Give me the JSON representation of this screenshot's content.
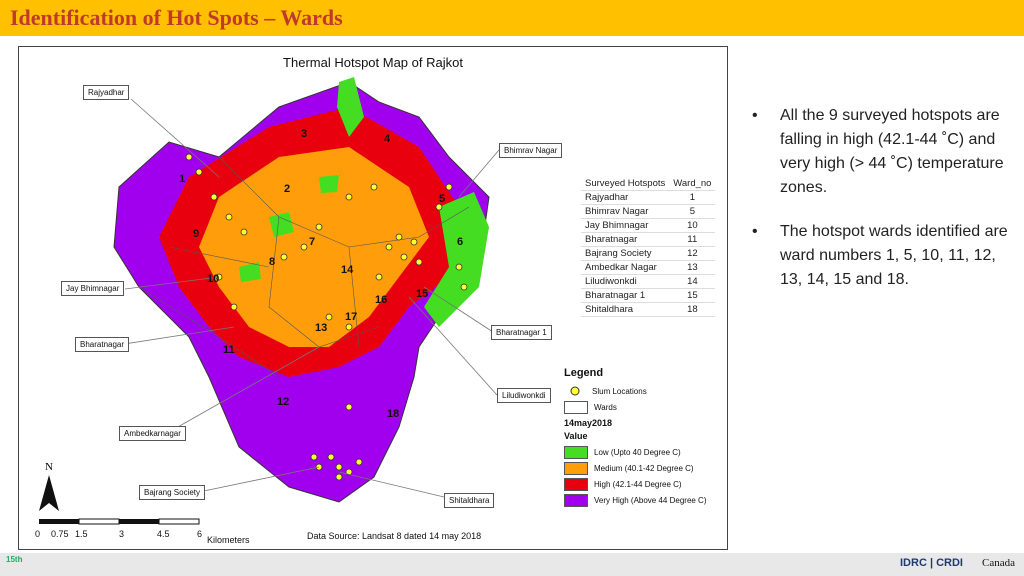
{
  "header": {
    "title": "Identification of Hot Spots – Wards"
  },
  "map": {
    "title": "Thermal Hotspot Map of Rajkot",
    "callouts": [
      "Rajyadhar",
      "Bhimrav Nagar",
      "Jay Bhimnagar",
      "Bharatnagar",
      "Bharatnagar 1",
      "Liludiwonkdi",
      "Ambedkarnagar",
      "Bajrang Society",
      "Shitaldhara"
    ],
    "ward_numbers": [
      "1",
      "2",
      "3",
      "4",
      "5",
      "6",
      "7",
      "8",
      "9",
      "10",
      "11",
      "12",
      "13",
      "14",
      "15",
      "16",
      "17",
      "18"
    ],
    "table": {
      "headers": [
        "Surveyed Hotspots",
        "Ward_no"
      ],
      "rows": [
        [
          "Rajyadhar",
          "1"
        ],
        [
          "Bhimrav Nagar",
          "5"
        ],
        [
          "Jay Bhimnagar",
          "10"
        ],
        [
          "Bharatnagar",
          "11"
        ],
        [
          "Bajrang Society",
          "12"
        ],
        [
          "Ambedkar Nagar",
          "13"
        ],
        [
          "Liludiwonkdi",
          "14"
        ],
        [
          "Bharatnagar 1",
          "15"
        ],
        [
          "Shitaldhara",
          "18"
        ]
      ]
    },
    "legend": {
      "title": "Legend",
      "slum": "Slum Locations",
      "wards": "Wards",
      "date": "14may2018",
      "value": "Value",
      "classes": [
        {
          "label": "Low (Upto 40 Degree C)",
          "color": "#44dd22"
        },
        {
          "label": "Medium (40.1-42 Degree C)",
          "color": "#ff9e0a"
        },
        {
          "label": "High (42.1-44 Degree C)",
          "color": "#e8000e"
        },
        {
          "label": "Very High (Above 44 Degree C)",
          "color": "#a000ee"
        }
      ]
    },
    "north_label": "N",
    "scale": {
      "ticks": [
        "0",
        "0.75",
        "1.5",
        "3",
        "4.5",
        "6"
      ],
      "unit": "Kilometers"
    },
    "source": "Data Source: Landsat 8 dated 14 may 2018"
  },
  "bullets": [
    "All the 9 surveyed hotspots are falling in high (42.1-44 ˚C) and very high (> 44 ˚C) temperature zones.",
    "The hotspot wards identified are ward numbers 1, 5, 10, 11, 12, 13, 14, 15 and 18."
  ],
  "footer": {
    "left_logo": "15th",
    "idrc": "IDRC | CRDI",
    "canada": "Canada"
  }
}
